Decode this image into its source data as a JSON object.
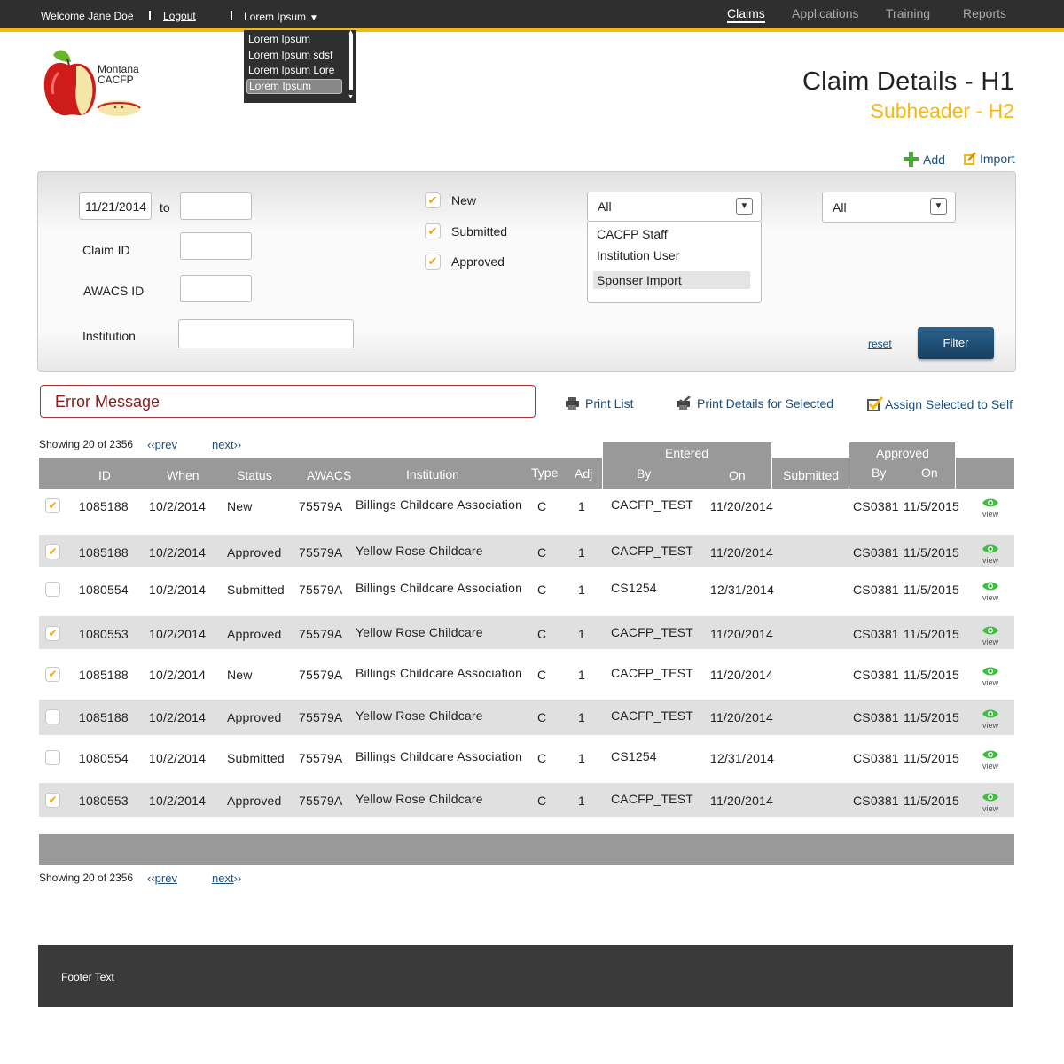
{
  "topbar": {
    "welcome": "Welcome Jane Doe",
    "logout": "Logout",
    "dropdown_value": "Lorem Ipsum",
    "dropdown_options": [
      "Lorem Ipsum",
      "Lorem Ipsum sdsf",
      "Lorem Ipsum Lore",
      "Lorem Ipsum"
    ],
    "nav": [
      "Claims",
      "Applications",
      "Training",
      "Reports"
    ],
    "accent": "#f5b80f"
  },
  "logo": {
    "line1": "Montana",
    "line2": "CACFP"
  },
  "page": {
    "title": "Claim Details - H1",
    "subtitle": "Subheader - H2"
  },
  "actions": {
    "add": "Add",
    "import": "Import"
  },
  "filter": {
    "date_from": "11/21/2014",
    "to_label": "to",
    "date_to": "",
    "claim_id_label": "Claim ID",
    "awacs_label": "AWACS ID",
    "institution_label": "Institution",
    "status_new": "New",
    "status_submitted": "Submitted",
    "status_approved": "Approved",
    "source_value": "All",
    "source_options": [
      "CACFP Staff",
      "Institution User",
      "Sponser Import"
    ],
    "second_value": "All",
    "reset": "reset",
    "filter_button": "Filter"
  },
  "error_message": "Error Message",
  "tools": {
    "print_list": "Print List",
    "print_details": "Print Details for Selected",
    "assign": "Assign Selected to Self"
  },
  "paging": {
    "showing": "Showing 20 of 2356",
    "prev": "prev",
    "next": "next"
  },
  "table": {
    "headers": {
      "id": "ID",
      "when": "When",
      "status": "Status",
      "awacs": "AWACS",
      "institution": "Institution",
      "type": "Type",
      "adj": "Adj",
      "entered": "Entered",
      "entered_by": "By",
      "entered_on": "On",
      "submitted": "Submitted",
      "approved": "Approved",
      "approved_by": "By",
      "approved_on": "On"
    },
    "view_label": "view",
    "rows": [
      {
        "checked": true,
        "id": "1085188",
        "when": "10/2/2014",
        "status": "New",
        "awacs": "75579A",
        "institution": "Billings Childcare Association",
        "type": "C",
        "adj": "1",
        "entered_by": "CACFP_TEST",
        "entered_on": "11/20/2014",
        "submitted": "",
        "approved_by": "CS0381",
        "approved_on": "11/5/2015"
      },
      {
        "checked": true,
        "id": "1085188",
        "when": "10/2/2014",
        "status": "Approved",
        "awacs": "75579A",
        "institution": "Yellow Rose Childcare",
        "type": "C",
        "adj": "1",
        "entered_by": "CACFP_TEST",
        "entered_on": "11/20/2014",
        "submitted": "",
        "approved_by": "CS0381",
        "approved_on": "11/5/2015"
      },
      {
        "checked": false,
        "id": "1080554",
        "when": "10/2/2014",
        "status": "Submitted",
        "awacs": "75579A",
        "institution": "Billings Childcare Association",
        "type": "C",
        "adj": "1",
        "entered_by": "CS1254",
        "entered_on": "12/31/2014",
        "submitted": "",
        "approved_by": "CS0381",
        "approved_on": "11/5/2015"
      },
      {
        "checked": true,
        "id": "1080553",
        "when": "10/2/2014",
        "status": "Approved",
        "awacs": "75579A",
        "institution": "Yellow Rose Childcare",
        "type": "C",
        "adj": "1",
        "entered_by": "CACFP_TEST",
        "entered_on": "11/20/2014",
        "submitted": "",
        "approved_by": "CS0381",
        "approved_on": "11/5/2015"
      },
      {
        "checked": true,
        "id": "1085188",
        "when": "10/2/2014",
        "status": "New",
        "awacs": "75579A",
        "institution": "Billings Childcare Association",
        "type": "C",
        "adj": "1",
        "entered_by": "CACFP_TEST",
        "entered_on": "11/20/2014",
        "submitted": "",
        "approved_by": "CS0381",
        "approved_on": "11/5/2015"
      },
      {
        "checked": false,
        "id": "1085188",
        "when": "10/2/2014",
        "status": "Approved",
        "awacs": "75579A",
        "institution": "Yellow Rose Childcare",
        "type": "C",
        "adj": "1",
        "entered_by": "CACFP_TEST",
        "entered_on": "11/20/2014",
        "submitted": "",
        "approved_by": "CS0381",
        "approved_on": "11/5/2015"
      },
      {
        "checked": false,
        "id": "1080554",
        "when": "10/2/2014",
        "status": "Submitted",
        "awacs": "75579A",
        "institution": "Billings Childcare Association",
        "type": "C",
        "adj": "1",
        "entered_by": "CS1254",
        "entered_on": "12/31/2014",
        "submitted": "",
        "approved_by": "CS0381",
        "approved_on": "11/5/2015"
      },
      {
        "checked": true,
        "id": "1080553",
        "when": "10/2/2014",
        "status": "Approved",
        "awacs": "75579A",
        "institution": "Yellow Rose Childcare",
        "type": "C",
        "adj": "1",
        "entered_by": "CACFP_TEST",
        "entered_on": "11/20/2014",
        "submitted": "",
        "approved_by": "CS0381",
        "approved_on": "11/5/2015"
      }
    ]
  },
  "footer": "Footer Text"
}
